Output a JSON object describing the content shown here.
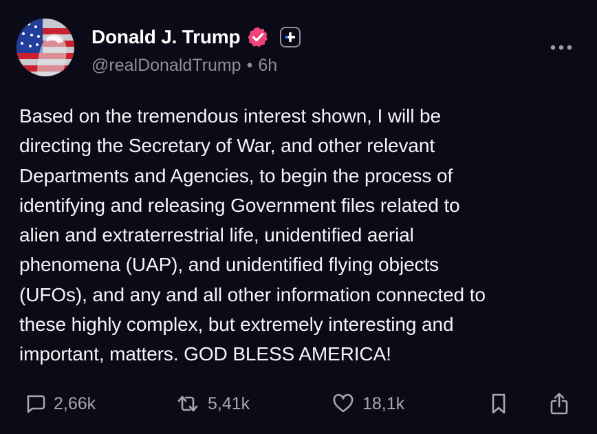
{
  "author": {
    "display_name": "Donald J. Trump",
    "handle": "@realDonaldTrump",
    "separator": "•",
    "time_ago": "6h",
    "verified_color": "#f0447a"
  },
  "post": {
    "text": "Based on the tremendous interest shown, I will be\ndirecting the Secretary of War, and other relevant\nDepartments and Agencies, to begin the process of\nidentifying and releasing Government files related to\nalien and extraterrestrial life, unidentified aerial\nphenomena (UAP), and unidentified flying objects\n(UFOs), and any and all other information connected to\nthese highly complex, but extremely interesting and\nimportant, matters. GOD BLESS AMERICA!"
  },
  "actions": {
    "replies": "2,66k",
    "reposts": "5,41k",
    "likes": "18,1k",
    "icons": [
      "reply-icon",
      "repost-icon",
      "heart-icon",
      "bookmark-icon",
      "share-icon"
    ]
  },
  "theme": {
    "background": "#0b0a17",
    "muted_text": "#8e8e9c"
  }
}
